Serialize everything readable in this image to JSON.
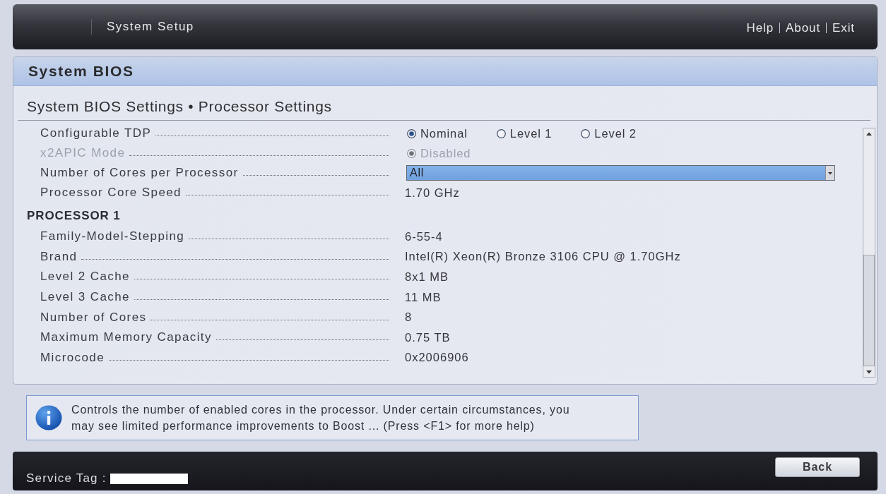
{
  "header": {
    "title": "System Setup",
    "links": [
      {
        "label": "Help"
      },
      {
        "label": "About"
      },
      {
        "label": "Exit"
      }
    ]
  },
  "panel": {
    "title": "System BIOS",
    "breadcrumb": "System BIOS Settings • Processor Settings"
  },
  "settings": [
    {
      "kind": "radio",
      "label": "Configurable TDP",
      "disabled": false,
      "options": [
        {
          "label": "Nominal",
          "selected": true
        },
        {
          "label": "Level 1",
          "selected": false
        },
        {
          "label": "Level 2",
          "selected": false
        }
      ]
    },
    {
      "kind": "radio",
      "label": "x2APIC Mode",
      "disabled": true,
      "options": [
        {
          "label": "Disabled",
          "selected": true
        }
      ]
    },
    {
      "kind": "dropdown",
      "label": "Number of Cores per Processor",
      "disabled": false,
      "value": "All",
      "focused": true
    },
    {
      "kind": "text",
      "label": "Processor Core Speed",
      "disabled": false,
      "value": "1.70 GHz"
    }
  ],
  "processor": {
    "heading": "PROCESSOR 1",
    "rows": [
      {
        "label": "Family-Model-Stepping",
        "value": "6-55-4"
      },
      {
        "label": "Brand",
        "value": "Intel(R) Xeon(R) Bronze 3106 CPU @ 1.70GHz"
      },
      {
        "label": "Level 2 Cache",
        "value": "8x1 MB"
      },
      {
        "label": "Level 3 Cache",
        "value": "11 MB"
      },
      {
        "label": "Number of Cores",
        "value": "8"
      },
      {
        "label": "Maximum Memory Capacity",
        "value": "0.75 TB"
      },
      {
        "label": "Microcode",
        "value": "0x2006906"
      }
    ]
  },
  "help": {
    "text": "Controls the number of enabled cores in the processor. Under certain circumstances, you\nmay see limited performance improvements to Boost ... (Press <F1> for more help)"
  },
  "footer": {
    "service_tag_label": "Service Tag :",
    "buttons": [
      {
        "label": "Back"
      }
    ]
  }
}
